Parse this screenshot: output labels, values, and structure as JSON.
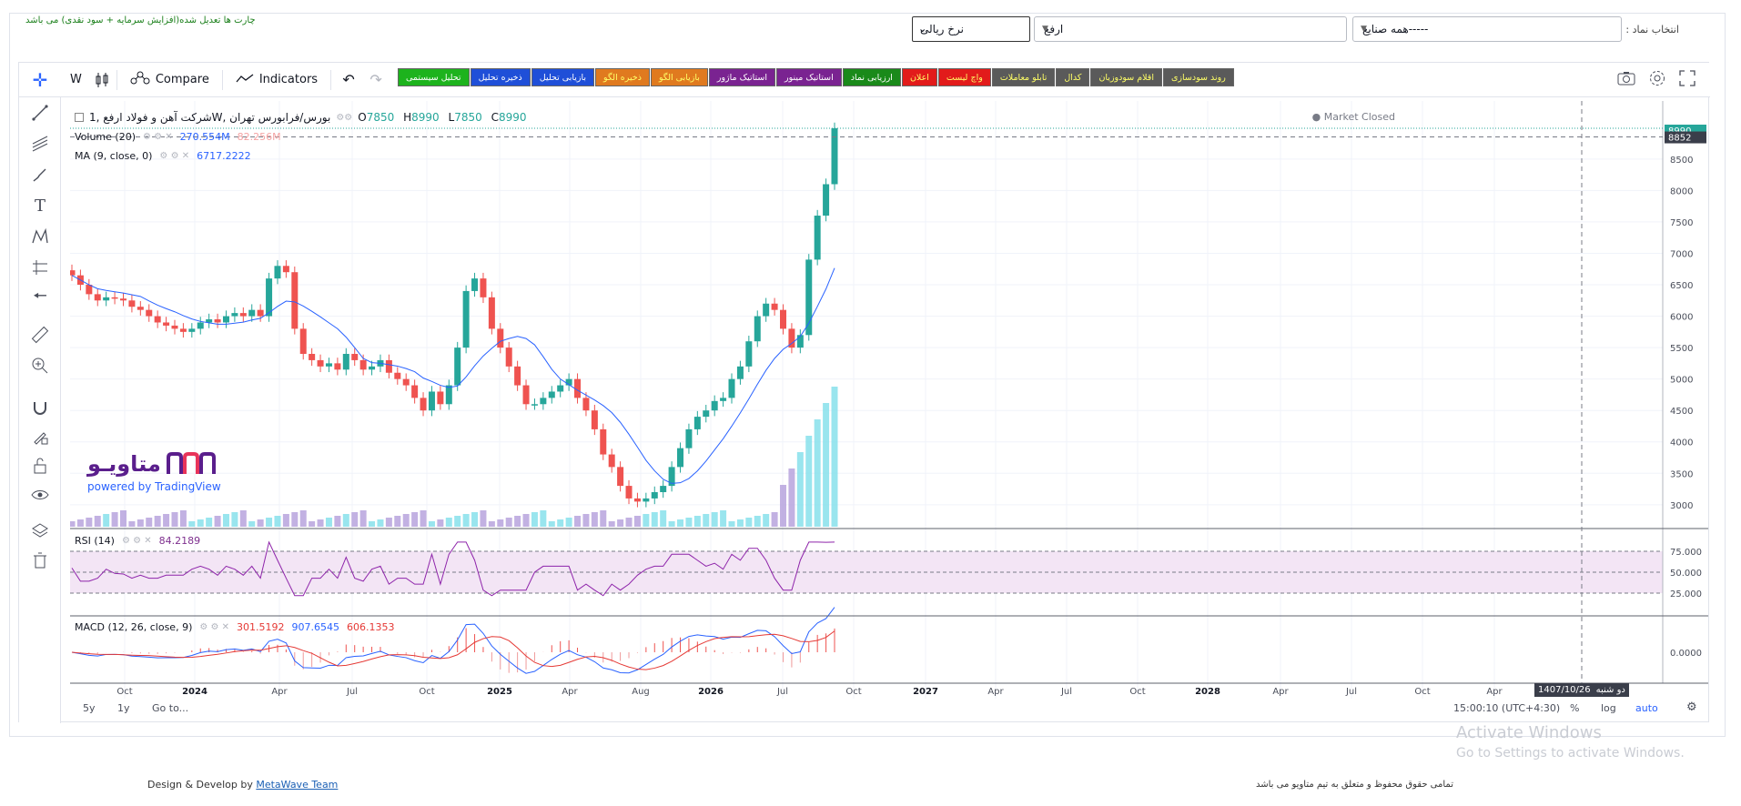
{
  "header": {
    "note": "چارت ها تعدیل شده(افزایش سرمایه + سود نقدی) می باشد",
    "select_label": "انتخاب نماد :",
    "industry_select": "-----همه صنایع",
    "symbol_select": "ارفع",
    "rate_select": "نرخ ریالی"
  },
  "toolbar": {
    "interval": "W",
    "compare": "Compare",
    "indicators": "Indicators",
    "buttons": [
      {
        "label": "تحلیل سیستمی",
        "bg": "#1db31d",
        "fg": "#ffffff"
      },
      {
        "label": "ذخیره تحلیل",
        "bg": "#1f4fd8",
        "fg": "#ffffff"
      },
      {
        "label": "بازیابی تحلیل",
        "bg": "#1f4fd8",
        "fg": "#ffffff"
      },
      {
        "label": "ذخیره الگو",
        "bg": "#e07a1f",
        "fg": "#ffff66"
      },
      {
        "label": "بازیابی الگو",
        "bg": "#e07a1f",
        "fg": "#ffff66"
      },
      {
        "label": "استاتیک ماژور",
        "bg": "#7a2391",
        "fg": "#ffffff"
      },
      {
        "label": "استاتیک مینور",
        "bg": "#7a2391",
        "fg": "#ffffff"
      },
      {
        "label": "ارزیابی نماد",
        "bg": "#1a8a1a",
        "fg": "#ffffff"
      },
      {
        "label": "اعلان",
        "bg": "#e21b1b",
        "fg": "#ffff66"
      },
      {
        "label": "واچ لیست",
        "bg": "#e21b1b",
        "fg": "#ffff66"
      },
      {
        "label": "تابلو معاملات",
        "bg": "#5a5a5a",
        "fg": "#ffff66"
      },
      {
        "label": "کدال",
        "bg": "#5a5a5a",
        "fg": "#ffff66"
      },
      {
        "label": "اقلام سودوزیان",
        "bg": "#5a5a5a",
        "fg": "#ffff66"
      },
      {
        "label": "روند سودسازی",
        "bg": "#5a5a5a",
        "fg": "#ffff66"
      }
    ]
  },
  "legend": {
    "title": "بورس/فرابورس تهران ,Wشرکت آهن و فولاد ارفع ,1",
    "o_label": "O",
    "o": "7850",
    "h_label": "H",
    "h": "8990",
    "l_label": "L",
    "l": "7850",
    "c_label": "C",
    "c": "8990",
    "market_status": "Market Closed",
    "volume": "Volume (20)",
    "volume_val": "270.554M",
    "volume_val2": "82.256M",
    "ma": "MA (9, close, 0)",
    "ma_val": "6717.2222",
    "rsi": "RSI (14)",
    "rsi_val": "84.2189",
    "macd": "MACD (12, 26, close, 9)",
    "macd_v1": "301.5192",
    "macd_v2": "907.6545",
    "macd_v3": "606.1353"
  },
  "logo": {
    "fa": "متاویـو",
    "powered": "powered by TradingView"
  },
  "bottom": {
    "range_5y": "5y",
    "range_1y": "1y",
    "goto": "Go to...",
    "time": "15:00:10 (UTC+4:30)",
    "pct": "%",
    "log": "log",
    "auto": "auto",
    "cursor_date": "1407/10/26",
    "cursor_day": "دو شنبه"
  },
  "watermark": {
    "title": "Activate Windows",
    "sub": "Go to Settings to activate Windows."
  },
  "footer": {
    "design": "Design & Develop by",
    "team": "MetaWave Team",
    "rights": "تمامی حقوق محفوظ و متعلق به تیم متاویو می باشد"
  },
  "chart_data": {
    "type": "candlestick",
    "price_axis": {
      "ticks": [
        3000,
        3500,
        4000,
        4500,
        5000,
        5500,
        6000,
        6500,
        7000,
        7500,
        8000,
        8500
      ],
      "ylim": [
        2650,
        8990
      ],
      "last_price": 8990,
      "crosshair_price": 8852
    },
    "x_tick_labels": [
      "Oct",
      "2024",
      "Apr",
      "Jul",
      "Oct",
      "2025",
      "Apr",
      "Aug",
      "2026",
      "Jul",
      "Oct",
      "2027",
      "Apr",
      "Jul",
      "Oct",
      "2028",
      "Apr",
      "Jul",
      "Oct",
      "Apr"
    ],
    "close_series": [
      6650,
      6500,
      6350,
      6250,
      6300,
      6280,
      6250,
      6150,
      6100,
      6000,
      5900,
      5850,
      5800,
      5750,
      5800,
      5900,
      5950,
      5900,
      6000,
      6050,
      6000,
      6100,
      6000,
      6600,
      6800,
      6700,
      5800,
      5400,
      5300,
      5200,
      5250,
      5150,
      5400,
      5300,
      5150,
      5200,
      5300,
      5100,
      5000,
      4900,
      4700,
      4500,
      4800,
      4600,
      4900,
      5500,
      6400,
      6600,
      6300,
      5800,
      5500,
      5200,
      4900,
      4600,
      4600,
      4700,
      4800,
      4900,
      5000,
      4700,
      4500,
      4200,
      3800,
      3600,
      3300,
      3100,
      3050,
      3100,
      3200,
      3300,
      3600,
      3900,
      4200,
      4400,
      4500,
      4650,
      4700,
      5000,
      5200,
      5600,
      6000,
      6200,
      6100,
      5800,
      5500,
      5700,
      6900,
      7600,
      8100,
      8990
    ],
    "ma_series_note": "MA(9) close",
    "rsi": {
      "last": 84.2189,
      "bands": [
        25,
        50,
        75
      ]
    },
    "macd": {
      "macd": 907.6545,
      "signal": 606.1353,
      "hist": 301.5192
    },
    "volume_last": "270.554M"
  }
}
